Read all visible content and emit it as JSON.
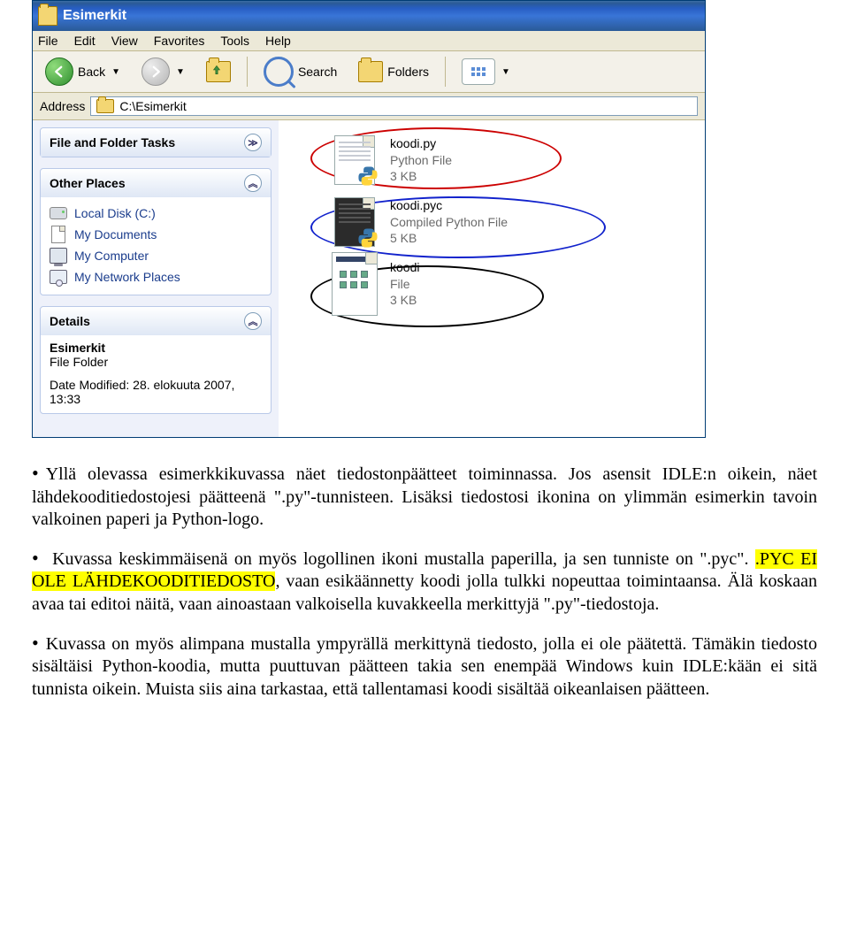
{
  "titlebar": {
    "title": "Esimerkit"
  },
  "menu": {
    "items": [
      "File",
      "Edit",
      "View",
      "Favorites",
      "Tools",
      "Help"
    ]
  },
  "toolbar": {
    "back": "Back",
    "search": "Search",
    "folders": "Folders"
  },
  "addressbar": {
    "label": "Address",
    "path": "C:\\Esimerkit"
  },
  "tasks": {
    "file_folder_tasks": "File and Folder Tasks",
    "other_places": "Other Places",
    "details": "Details"
  },
  "places": {
    "local_disk": "Local Disk (C:)",
    "my_documents": "My Documents",
    "my_computer": "My Computer",
    "my_network": "My Network Places"
  },
  "details_panel": {
    "name": "Esimerkit",
    "kind": "File Folder",
    "modified": "Date Modified: 28. elokuuta 2007, 13:33"
  },
  "files": [
    {
      "name": "koodi.py",
      "type": "Python File",
      "size": "3 KB"
    },
    {
      "name": "koodi.pyc",
      "type": "Compiled Python File",
      "size": "5 KB"
    },
    {
      "name": "koodi",
      "type": "File",
      "size": "3 KB"
    }
  ],
  "paragraphs": {
    "p1a": "Yllä olevassa esimerkkikuvassa näet tiedostonpäätteet toiminnassa. Jos asensit IDLE:n oikein, näet lähdekooditiedostojesi päätteenä \".py\"-tunnisteen. Lisäksi tiedostosi ikonina on ylimmän esimerkin tavoin valkoinen paperi ja Python-logo.",
    "p2a": "Kuvassa keskimmäisenä on myös logollinen ikoni mustalla paperilla, ja sen tunniste on \".pyc\". ",
    "p2hl": ".PYC EI OLE LÄHDEKOODITIEDOSTO",
    "p2b": ", vaan esikäännetty koodi jolla tulkki nopeuttaa toimintaansa. Älä koskaan avaa tai editoi näitä, vaan ainoastaan valkoisella kuvakkeella merkittyjä \".py\"-tiedostoja.",
    "p3": "Kuvassa on myös alimpana mustalla ympyrällä merkittynä tiedosto, jolla ei ole päätettä. Tämäkin tiedosto sisältäisi Python-koodia, mutta puuttuvan päätteen takia sen enempää Windows kuin IDLE:kään ei sitä tunnista oikein. Muista siis aina tarkastaa, että tallentamasi koodi sisältää oikeanlaisen päätteen."
  }
}
